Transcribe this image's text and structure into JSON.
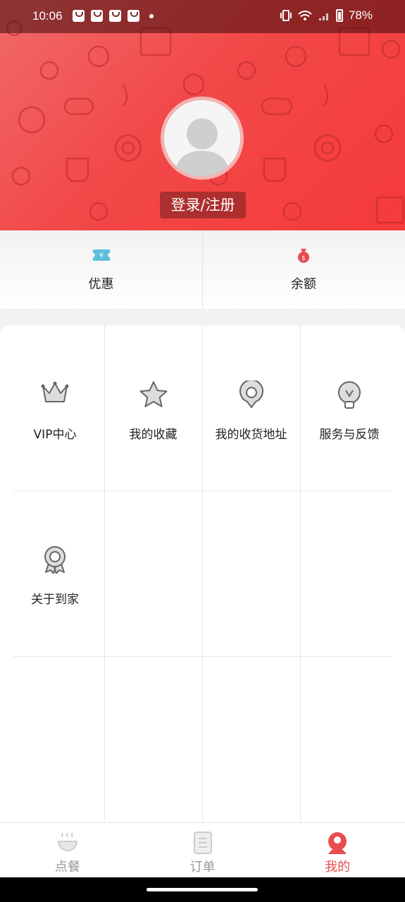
{
  "status": {
    "time": "10:06",
    "battery": "78%"
  },
  "profile": {
    "login_label": "登录/注册"
  },
  "quick": [
    {
      "label": "优惠",
      "icon": "coupon-icon",
      "color": "#5bc0de"
    },
    {
      "label": "余额",
      "icon": "money-bag-icon",
      "color": "#e84b50"
    }
  ],
  "menu": [
    {
      "label": "VIP中心",
      "icon": "crown-icon"
    },
    {
      "label": "我的收藏",
      "icon": "star-icon"
    },
    {
      "label": "我的收货地址",
      "icon": "location-icon"
    },
    {
      "label": "服务与反馈",
      "icon": "lightbulb-icon"
    },
    {
      "label": "关于到家",
      "icon": "award-icon"
    }
  ],
  "nav": [
    {
      "label": "点餐",
      "icon": "bowl-icon",
      "active": false
    },
    {
      "label": "订单",
      "icon": "list-icon",
      "active": false
    },
    {
      "label": "我的",
      "icon": "user-icon",
      "active": true
    }
  ],
  "colors": {
    "accent": "#e84b50",
    "header": "#f24848"
  }
}
